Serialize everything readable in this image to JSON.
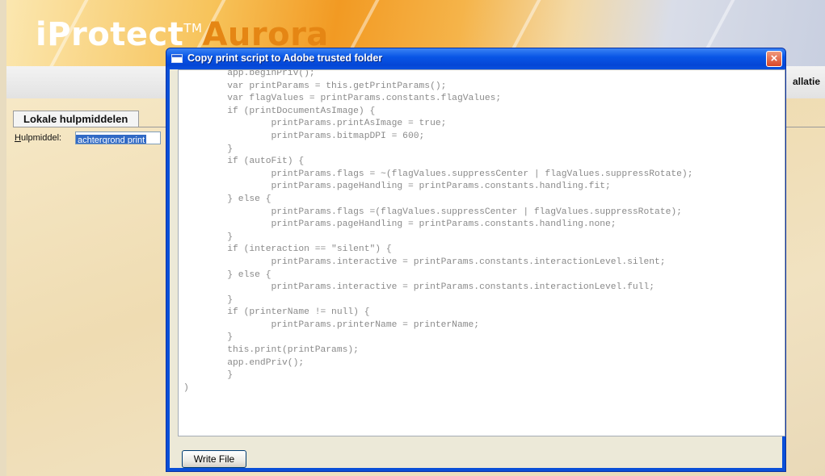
{
  "app": {
    "logo_main": "iProtect",
    "logo_tm": "TM",
    "logo_sub": "Aurora",
    "nav_right_label": "allatie"
  },
  "panel": {
    "tab_label": "Lokale hulpmiddelen",
    "field_label_accesskey": "H",
    "field_label_rest": "ulpmiddel:",
    "field_value": "achtergrond print"
  },
  "dialog": {
    "title": "Copy print script to Adobe trusted folder",
    "close_symbol": "×",
    "code_lines": [
      "        app.beginPriv();",
      "        var printParams = this.getPrintParams();",
      "        var flagValues = printParams.constants.flagValues;",
      "        if (printDocumentAsImage) {",
      "                printParams.printAsImage = true;",
      "                printParams.bitmapDPI = 600;",
      "        }",
      "        if (autoFit) {",
      "                printParams.flags = ~(flagValues.suppressCenter | flagValues.suppressRotate);",
      "                printParams.pageHandling = printParams.constants.handling.fit;",
      "        } else {",
      "                printParams.flags =(flagValues.suppressCenter | flagValues.suppressRotate);",
      "                printParams.pageHandling = printParams.constants.handling.none;",
      "        }",
      "        if (interaction == \"silent\") {",
      "                printParams.interactive = printParams.constants.interactionLevel.silent;",
      "        } else {",
      "                printParams.interactive = printParams.constants.interactionLevel.full;",
      "        }",
      "        if (printerName != null) {",
      "                printParams.printerName = printerName;",
      "        }",
      "        this.print(printParams);",
      "        app.endPriv();",
      "        }",
      ")"
    ],
    "write_button_label": "Write File"
  }
}
